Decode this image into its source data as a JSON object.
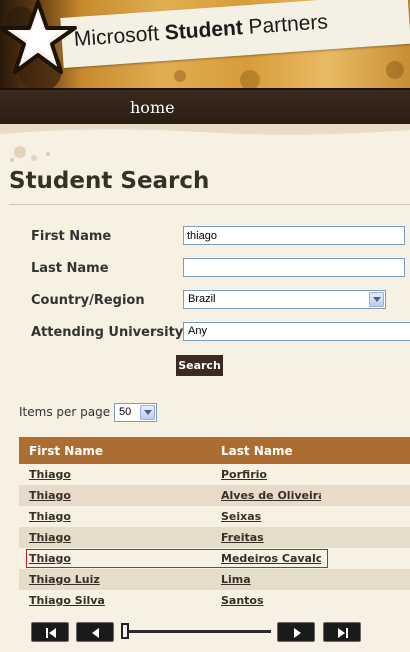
{
  "header": {
    "logo_prefix": "Microsoft",
    "logo_bold": "Student",
    "logo_suffix": "Partners",
    "brand_color": "#c98a2c"
  },
  "nav": {
    "home_label": "home"
  },
  "page": {
    "title": "Student Search"
  },
  "form": {
    "first_name_label": "First Name",
    "first_name_value": "thiago",
    "last_name_label": "Last Name",
    "last_name_value": "",
    "country_label": "Country/Region",
    "country_value": "Brazil",
    "university_label": "Attending University",
    "university_value": "Any",
    "search_label": "Search"
  },
  "paging": {
    "items_per_page_label": "Items per page",
    "items_per_page_value": "50"
  },
  "results": {
    "headers": [
      "First Name",
      "Last Name"
    ],
    "rows": [
      {
        "first": "Thiago",
        "last": "Porfirio"
      },
      {
        "first": "Thiago",
        "last": "Alves de Oliveira I"
      },
      {
        "first": "Thiago",
        "last": "Seixas"
      },
      {
        "first": "Thiago",
        "last": "Freitas"
      },
      {
        "first": "Thiago",
        "last": "Medeiros Cavalcanti"
      },
      {
        "first": "Thiago Luiz",
        "last": "Lima"
      },
      {
        "first": "Thiago Silva",
        "last": "Santos"
      }
    ],
    "selected_row_index": 4
  },
  "pager": {
    "first_icon": "first-page-icon",
    "prev_icon": "previous-page-icon",
    "next_icon": "next-page-icon",
    "last_icon": "last-page-icon"
  }
}
